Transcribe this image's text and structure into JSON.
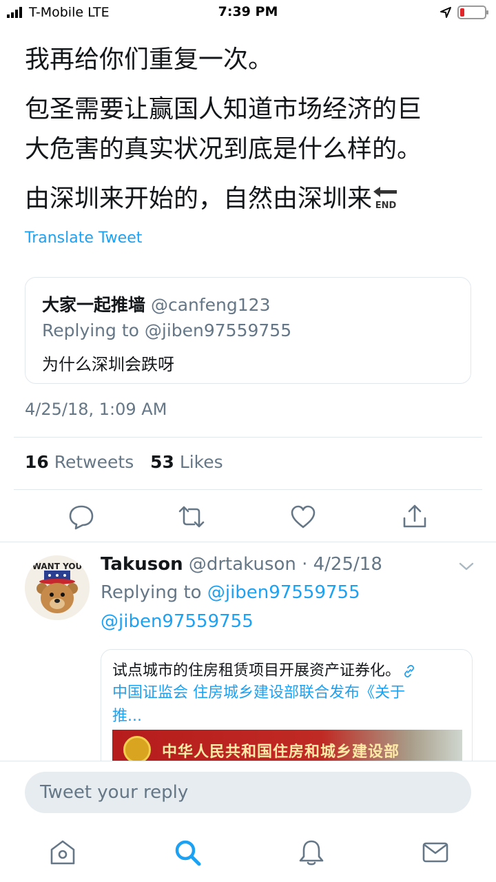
{
  "status_bar": {
    "carrier": "T-Mobile   LTE",
    "time": "7:39 PM"
  },
  "tweet": {
    "lines": [
      "我再给你们重复一次。",
      "包圣需要让赢国人知道市场经济的巨",
      "大危害的真实状况到底是什么样的。",
      "由深圳来开始的，自然由深圳来"
    ],
    "end_icon_text": "END",
    "translate_label": "Translate Tweet",
    "quoted": {
      "name": "大家一起推墙",
      "handle": "@canfeng123",
      "replying": "Replying to @jiben97559755",
      "text": "为什么深圳会跌呀"
    },
    "timestamp": "4/25/18, 1:09 AM",
    "stats": {
      "retweets_count": "16",
      "retweets_label": "Retweets",
      "likes_count": "53",
      "likes_label": "Likes"
    }
  },
  "reply": {
    "avatar_text": "WANT YOU",
    "name": "Takuson",
    "meta": "@drtakuson · 4/25/18",
    "replying_prefix": "Replying to",
    "replying_handle": "@jiben97559755",
    "mention": "@jiben97559755",
    "link_card": {
      "title": "试点城市的住房租赁项目开展资产证券化。",
      "desc_line1": "中国证监会 住房城乡建设部联合发布《关于",
      "desc_line2": "推...",
      "banner_text": "中华人民共和国住房和城乡建设部"
    }
  },
  "composer": {
    "placeholder": "Tweet your reply"
  },
  "icons": {
    "accent": "#1da1f2",
    "muted": "#657786"
  }
}
